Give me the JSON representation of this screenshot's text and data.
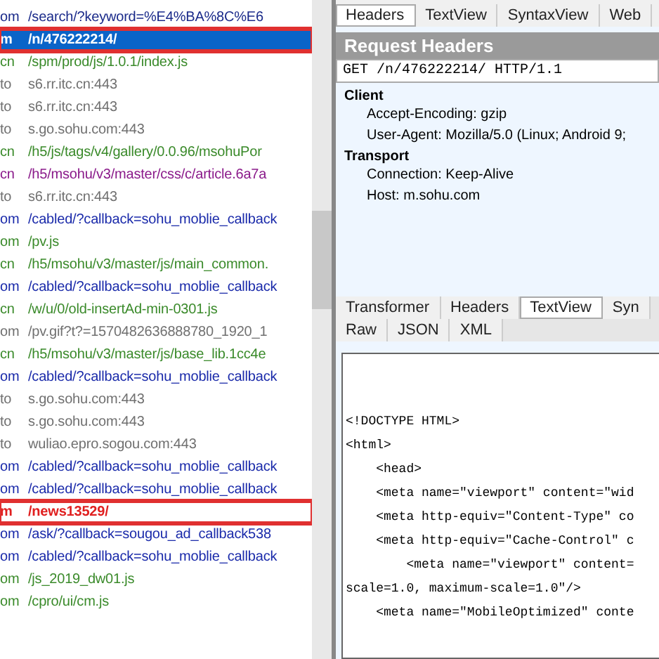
{
  "sessions": [
    {
      "host": "om",
      "url": "/search/?keyword=%E4%BA%8C%E6",
      "color": "#1a2a8a",
      "selected": false,
      "boxed": false
    },
    {
      "host": "m",
      "url": "/n/476222214/",
      "color": "#ffffff",
      "selected": true,
      "boxed": true
    },
    {
      "host": "cn",
      "url": "/spm/prod/js/1.0.1/index.js",
      "color": "#3a8a2a",
      "selected": false,
      "boxed": false
    },
    {
      "host": "to",
      "url": "s6.rr.itc.cn:443",
      "color": "#707070",
      "selected": false,
      "boxed": false
    },
    {
      "host": "to",
      "url": "s6.rr.itc.cn:443",
      "color": "#707070",
      "selected": false,
      "boxed": false
    },
    {
      "host": "to",
      "url": "s.go.sohu.com:443",
      "color": "#707070",
      "selected": false,
      "boxed": false
    },
    {
      "host": "cn",
      "url": "/h5/js/tags/v4/gallery/0.0.96/msohuPor",
      "color": "#3a8a2a",
      "selected": false,
      "boxed": false
    },
    {
      "host": "cn",
      "url": "/h5/msohu/v3/master/css/c/article.6a7a",
      "color": "#8a1a8a",
      "selected": false,
      "boxed": false
    },
    {
      "host": "to",
      "url": "s6.rr.itc.cn:443",
      "color": "#707070",
      "selected": false,
      "boxed": false
    },
    {
      "host": "om",
      "url": "/cabled/?callback=sohu_moblie_callback",
      "color": "#1a2aaa",
      "selected": false,
      "boxed": false
    },
    {
      "host": "om",
      "url": "/pv.js",
      "color": "#3a8a2a",
      "selected": false,
      "boxed": false
    },
    {
      "host": "cn",
      "url": "/h5/msohu/v3/master/js/main_common.",
      "color": "#3a8a2a",
      "selected": false,
      "boxed": false
    },
    {
      "host": "om",
      "url": "/cabled/?callback=sohu_moblie_callback",
      "color": "#1a2aaa",
      "selected": false,
      "boxed": false
    },
    {
      "host": "cn",
      "url": "/w/u/0/old-insertAd-min-0301.js",
      "color": "#3a8a2a",
      "selected": false,
      "boxed": false
    },
    {
      "host": "om",
      "url": "/pv.gif?t?=1570482636888780_1920_1",
      "color": "#707070",
      "selected": false,
      "boxed": false
    },
    {
      "host": "cn",
      "url": "/h5/msohu/v3/master/js/base_lib.1cc4e",
      "color": "#3a8a2a",
      "selected": false,
      "boxed": false
    },
    {
      "host": "om",
      "url": "/cabled/?callback=sohu_moblie_callback",
      "color": "#1a2aaa",
      "selected": false,
      "boxed": false
    },
    {
      "host": "to",
      "url": "s.go.sohu.com:443",
      "color": "#707070",
      "selected": false,
      "boxed": false
    },
    {
      "host": "to",
      "url": "s.go.sohu.com:443",
      "color": "#707070",
      "selected": false,
      "boxed": false
    },
    {
      "host": "to",
      "url": "wuliao.epro.sogou.com:443",
      "color": "#707070",
      "selected": false,
      "boxed": false
    },
    {
      "host": "om",
      "url": "/cabled/?callback=sohu_moblie_callback",
      "color": "#1a2aaa",
      "selected": false,
      "boxed": false
    },
    {
      "host": "om",
      "url": "/cabled/?callback=sohu_moblie_callback",
      "color": "#1a2aaa",
      "selected": false,
      "boxed": false
    },
    {
      "host": "m",
      "url": "/news13529/",
      "color": "#e02020",
      "selected": false,
      "boxed": true
    },
    {
      "host": "om",
      "url": "/ask/?callback=sougou_ad_callback538",
      "color": "#1a2aaa",
      "selected": false,
      "boxed": false
    },
    {
      "host": "om",
      "url": "/cabled/?callback=sohu_moblie_callback",
      "color": "#1a2aaa",
      "selected": false,
      "boxed": false
    },
    {
      "host": "om",
      "url": "/js_2019_dw01.js",
      "color": "#3a8a2a",
      "selected": false,
      "boxed": false
    },
    {
      "host": "om",
      "url": "/cpro/ui/cm.js",
      "color": "#3a8a2a",
      "selected": false,
      "boxed": false
    }
  ],
  "request_tabs": [
    {
      "label": "Headers",
      "selected": true
    },
    {
      "label": "TextView",
      "selected": false
    },
    {
      "label": "SyntaxView",
      "selected": false
    },
    {
      "label": "Web",
      "selected": false
    }
  ],
  "request_headers": {
    "title": "Request Headers",
    "request_line": "GET /n/476222214/ HTTP/1.1",
    "groups": [
      {
        "name": "Client",
        "items": [
          "Accept-Encoding: gzip",
          "User-Agent: Mozilla/5.0 (Linux; Android 9;"
        ]
      },
      {
        "name": "Transport",
        "items": [
          "Connection: Keep-Alive",
          "Host: m.sohu.com"
        ]
      }
    ]
  },
  "response_tabs": [
    {
      "label": "Transformer",
      "selected": false
    },
    {
      "label": "Headers",
      "selected": false
    },
    {
      "label": "TextView",
      "selected": true
    },
    {
      "label": "Syn",
      "selected": false
    }
  ],
  "response_subtabs": [
    {
      "label": "Raw",
      "selected": false
    },
    {
      "label": "JSON",
      "selected": false
    },
    {
      "label": "XML",
      "selected": false
    }
  ],
  "response_body": [
    "<!DOCTYPE HTML>",
    "<html>",
    "    <head>",
    "    <meta name=\"viewport\" content=\"wid",
    "    <meta http-equiv=\"Content-Type\" co",
    "    <meta http-equiv=\"Cache-Control\" c",
    "        <meta name=\"viewport\" content=",
    "scale=1.0, maximum-scale=1.0\"/>",
    "    <meta name=\"MobileOptimized\" conte"
  ]
}
